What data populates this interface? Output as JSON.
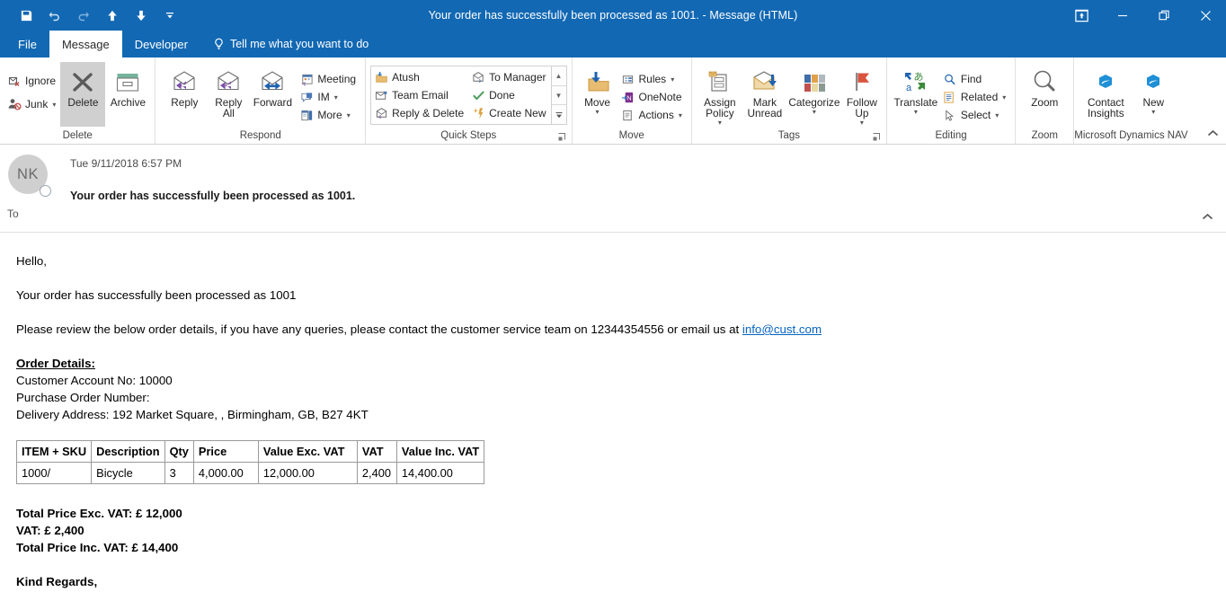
{
  "window": {
    "title": "Your order  has successfully been processed as 1001.  -  Message (HTML)",
    "accent_color": "#1268b3",
    "quick_access": [
      {
        "name": "save",
        "icon": "save-icon",
        "label": "Save"
      },
      {
        "name": "undo",
        "icon": "undo-icon",
        "label": "Undo"
      },
      {
        "name": "redo",
        "icon": "redo-icon",
        "label": "Redo"
      },
      {
        "name": "previous-item",
        "icon": "arrow-up-icon",
        "label": "Previous Item"
      },
      {
        "name": "next-item",
        "icon": "arrow-down-icon",
        "label": "Next Item"
      },
      {
        "name": "customize-qat",
        "icon": "chevron-down-icon",
        "label": "Customize Quick Access Toolbar"
      }
    ],
    "controls": [
      {
        "name": "touch-mode",
        "icon": "touch-mode-icon",
        "label": "Touch/Mouse Mode"
      },
      {
        "name": "minimize",
        "icon": "minimize-icon",
        "label": "Minimize"
      },
      {
        "name": "restore",
        "icon": "restore-icon",
        "label": "Restore Down"
      },
      {
        "name": "close",
        "icon": "close-icon",
        "label": "Close"
      }
    ]
  },
  "tabs": [
    {
      "label": "File",
      "active": false
    },
    {
      "label": "Message",
      "active": true
    },
    {
      "label": "Developer",
      "active": false
    }
  ],
  "tell_me": {
    "label": "Tell me what you want to do",
    "icon": "lightbulb-icon"
  },
  "ribbon": {
    "collapse_label": "Collapse the Ribbon",
    "groups": [
      {
        "name": "delete",
        "label": "Delete",
        "small_items": [
          {
            "label": "Ignore",
            "icon": "ignore-icon",
            "caret": false
          },
          {
            "label": "Junk",
            "icon": "junk-icon",
            "caret": true
          }
        ],
        "big_items": [
          {
            "label": "Delete",
            "icon": "delete-x-icon",
            "caret": false,
            "selected": true
          },
          {
            "label": "Archive",
            "icon": "archive-box-icon",
            "caret": false,
            "selected": false
          }
        ]
      },
      {
        "name": "respond",
        "label": "Respond",
        "big_items": [
          {
            "label": "Reply",
            "icon": "reply-icon",
            "caret": false
          },
          {
            "label": "Reply All",
            "icon": "reply-all-icon",
            "caret": false
          },
          {
            "label": "Forward",
            "icon": "forward-icon",
            "caret": false
          }
        ],
        "small_items": [
          {
            "label": "Meeting",
            "icon": "meeting-icon",
            "caret": false
          },
          {
            "label": "IM",
            "icon": "im-icon",
            "caret": true
          },
          {
            "label": "More",
            "icon": "more-icon",
            "caret": true
          }
        ]
      },
      {
        "name": "quick-steps",
        "label": "Quick Steps",
        "dialog_launcher": "quick-steps-dialog-launcher",
        "gallery_col_a": [
          {
            "label": "Atush",
            "icon": "move-to-folder-icon"
          },
          {
            "label": "Team Email",
            "icon": "team-email-icon"
          },
          {
            "label": "Reply & Delete",
            "icon": "reply-delete-icon"
          }
        ],
        "gallery_col_b": [
          {
            "label": "To Manager",
            "icon": "to-manager-icon"
          },
          {
            "label": "Done",
            "icon": "done-check-icon"
          },
          {
            "label": "Create New",
            "icon": "create-new-icon"
          }
        ],
        "scroll_buttons": [
          {
            "name": "quick-steps-scroll-up",
            "icon": "caret-up-icon"
          },
          {
            "name": "quick-steps-scroll-down",
            "icon": "caret-down-icon"
          },
          {
            "name": "quick-steps-more",
            "icon": "more-gallery-icon"
          }
        ]
      },
      {
        "name": "move",
        "label": "Move",
        "big_items": [
          {
            "label": "Move",
            "icon": "move-folder-icon",
            "caret": true
          }
        ],
        "small_items": [
          {
            "label": "Rules",
            "icon": "rules-icon",
            "caret": true
          },
          {
            "label": "OneNote",
            "icon": "onenote-icon",
            "caret": false
          },
          {
            "label": "Actions",
            "icon": "actions-icon",
            "caret": true
          }
        ]
      },
      {
        "name": "tags",
        "label": "Tags",
        "dialog_launcher": "tags-dialog-launcher",
        "big_items": [
          {
            "label": "Assign Policy",
            "icon": "assign-policy-icon",
            "caret": true
          },
          {
            "label": "Mark Unread",
            "icon": "mark-unread-icon",
            "caret": false
          },
          {
            "label": "Categorize",
            "icon": "categorize-icon",
            "caret": true
          },
          {
            "label": "Follow Up",
            "icon": "follow-up-flag-icon",
            "caret": true
          }
        ]
      },
      {
        "name": "editing",
        "label": "Editing",
        "big_items": [
          {
            "label": "Translate",
            "icon": "translate-icon",
            "caret": true
          }
        ],
        "small_items": [
          {
            "label": "Find",
            "icon": "find-magnifier-icon",
            "caret": false
          },
          {
            "label": "Related",
            "icon": "related-icon",
            "caret": true
          },
          {
            "label": "Select",
            "icon": "select-pointer-icon",
            "caret": true
          }
        ]
      },
      {
        "name": "zoom",
        "label": "Zoom",
        "big_items": [
          {
            "label": "Zoom",
            "icon": "zoom-magnifier-icon",
            "caret": false
          }
        ]
      },
      {
        "name": "microsoft-dynamics-nav",
        "label": "Microsoft Dynamics NAV",
        "big_items": [
          {
            "label": "Contact Insights",
            "icon": "dynamics-nav-icon",
            "caret": false
          },
          {
            "label": "New",
            "icon": "dynamics-nav-icon",
            "caret": true
          }
        ]
      }
    ]
  },
  "message": {
    "avatar_initials": "NK",
    "date": "Tue 9/11/2018 6:57 PM",
    "subject": "Your order  has successfully been processed as 1001.",
    "to_label": "To",
    "to_value": "",
    "expand_label": "Expand"
  },
  "body": {
    "greeting": "Hello,",
    "line_order": "Your order has successfully been processed as 1001",
    "line_review_prefix": "Please review the below order details, if you have any queries, please contact the customer service team on 12344354556 or email us at ",
    "email_link": "info@cust.com",
    "order_details_heading": "Order Details:",
    "customer_account": "Customer Account No: 10000",
    "purchase_order": "Purchase Order Number:",
    "delivery_address": "Delivery Address: 192 Market Square, , Birmingham, GB, B27 4KT",
    "table": {
      "headers": [
        "ITEM + SKU",
        "Description",
        "Qty",
        "Price",
        "Value Exc. VAT",
        "VAT",
        "Value Inc. VAT"
      ],
      "rows": [
        [
          "1000/",
          "Bicycle",
          "3",
          "4,000.00",
          "12,000.00",
          "2,400",
          "14,400.00"
        ]
      ]
    },
    "totals": [
      "Total Price Exc. VAT: £ 12,000",
      "VAT: £ 2,400",
      "Total Price Inc. VAT: £ 14,400"
    ],
    "signoff": "Kind Regards,"
  }
}
